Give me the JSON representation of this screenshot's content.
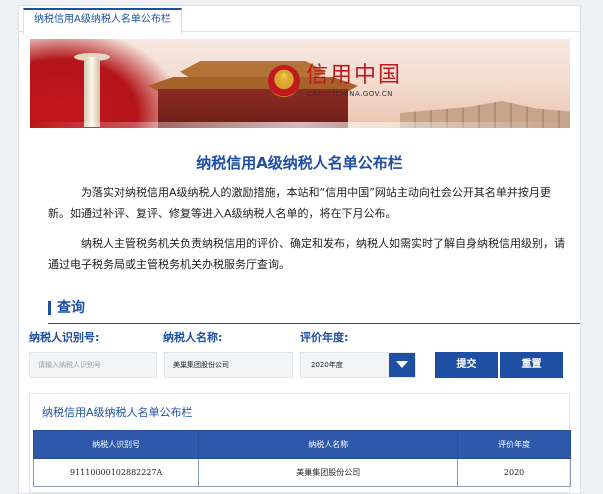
{
  "tab": {
    "label": "纳税信用A级纳税人名单公布栏"
  },
  "banner": {
    "logo_cn": "信用中国",
    "logo_en": "CREDITCHINA.GOV.CN"
  },
  "page": {
    "title": "纳税信用A级纳税人名单公布栏",
    "para1": "为落实对纳税信用A级纳税人的激励措施，本站和“信用中国”网站主动向社会公开其名单并按月更新。如通过补评、复评、修复等进入A级纳税人名单的，将在下月公布。",
    "para2": "纳税人主管税务机关负责纳税信用的评价、确定和发布，纳税人如需实时了解自身纳税信用级别，请通过电子税务局或主管税务机关办税服务厅查询。"
  },
  "query": {
    "section_title": "查询",
    "id_label": "纳税人识别号:",
    "name_label": "纳税人名称:",
    "year_label": "评价年度:",
    "id_placeholder": "请输入纳税人识别号",
    "name_value": "美巢集团股份公司",
    "year_value": "2020年度",
    "submit": "提交",
    "reset": "重置"
  },
  "results": {
    "title": "纳税信用A级纳税人名单公布栏",
    "columns": [
      "纳税人识别号",
      "纳税人名称",
      "评价年度"
    ],
    "rows": [
      [
        "91110000102882227A",
        "美巢集团股份公司",
        "2020"
      ]
    ]
  },
  "colors": {
    "accent": "#1f4fa3",
    "brand_red": "#c0181e"
  }
}
